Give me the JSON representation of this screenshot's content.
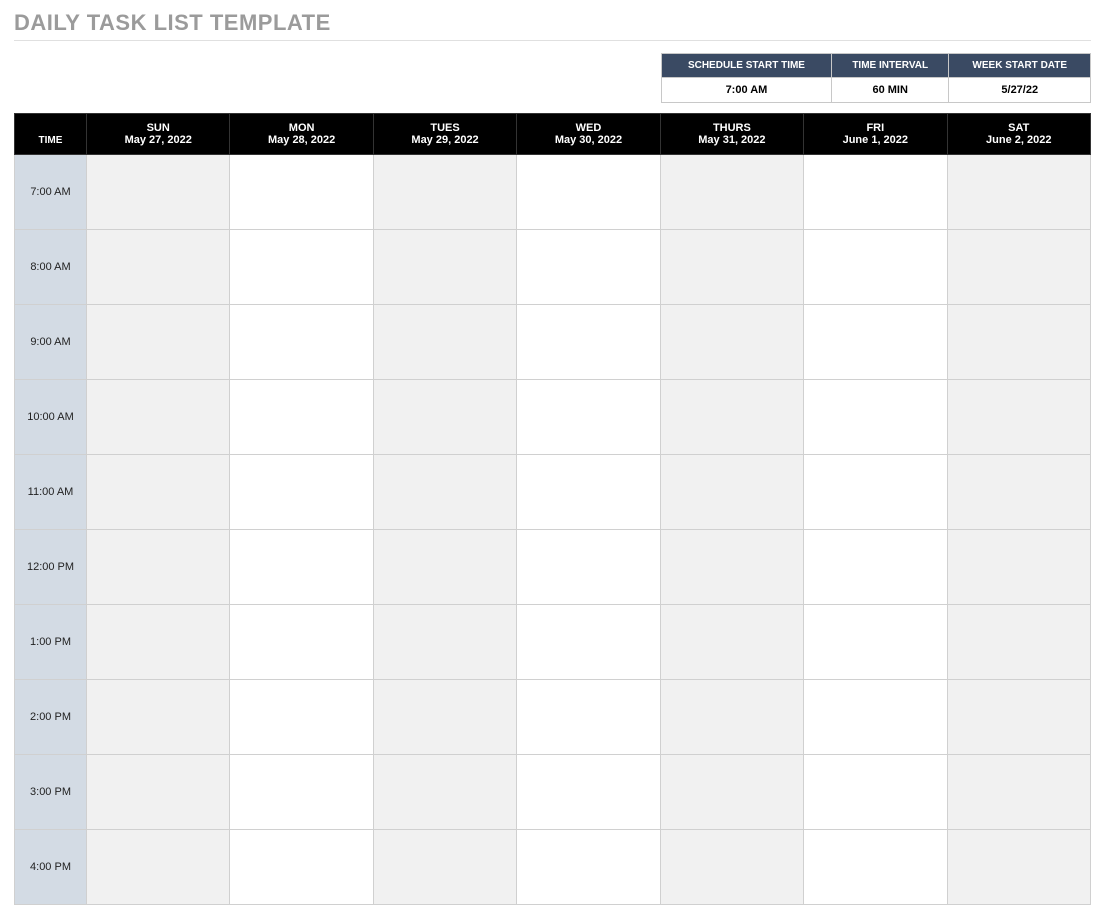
{
  "title": "DAILY TASK LIST TEMPLATE",
  "settings": {
    "headers": [
      "SCHEDULE START TIME",
      "TIME INTERVAL",
      "WEEK START DATE"
    ],
    "values": [
      "7:00 AM",
      "60 MIN",
      "5/27/22"
    ]
  },
  "schedule": {
    "time_label": "TIME",
    "days": [
      {
        "abbr": "SUN",
        "date": "May 27, 2022"
      },
      {
        "abbr": "MON",
        "date": "May 28, 2022"
      },
      {
        "abbr": "TUES",
        "date": "May 29, 2022"
      },
      {
        "abbr": "WED",
        "date": "May 30, 2022"
      },
      {
        "abbr": "THURS",
        "date": "May 31, 2022"
      },
      {
        "abbr": "FRI",
        "date": "June 1, 2022"
      },
      {
        "abbr": "SAT",
        "date": "June 2, 2022"
      }
    ],
    "times": [
      "7:00 AM",
      "8:00 AM",
      "9:00 AM",
      "10:00 AM",
      "11:00 AM",
      "12:00 PM",
      "1:00 PM",
      "2:00 PM",
      "3:00 PM",
      "4:00 PM"
    ]
  }
}
